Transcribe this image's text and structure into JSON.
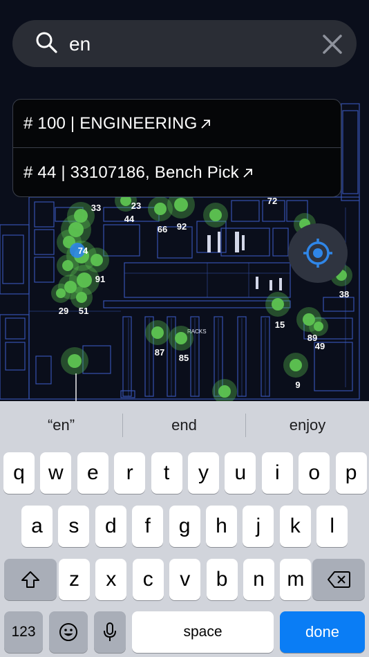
{
  "search": {
    "query": "en",
    "placeholder": ""
  },
  "results": [
    {
      "label": "# 100 | ENGINEERING"
    },
    {
      "label": "# 44 | 33107186, Bench Pick"
    }
  ],
  "map": {
    "markers": [
      "33",
      "23",
      "44",
      "66",
      "92",
      "72",
      "74",
      "91",
      "29",
      "51",
      "15",
      "89",
      "49",
      "38",
      "87",
      "85",
      "9"
    ],
    "racks_label": "RACKS"
  },
  "suggestions": [
    "“en”",
    "end",
    "enjoy"
  ],
  "keyboard": {
    "row1": [
      "q",
      "w",
      "e",
      "r",
      "t",
      "y",
      "u",
      "i",
      "o",
      "p"
    ],
    "row2": [
      "a",
      "s",
      "d",
      "f",
      "g",
      "h",
      "j",
      "k",
      "l"
    ],
    "row3": [
      "z",
      "x",
      "c",
      "v",
      "b",
      "n",
      "m"
    ],
    "numbers_label": "123",
    "space_label": "space",
    "done_label": "done"
  },
  "colors": {
    "accent": "#0a7df5",
    "marker_green": "#5dc351",
    "marker_blue": "#2f86e8",
    "blueprint": "#3d5fc9"
  }
}
